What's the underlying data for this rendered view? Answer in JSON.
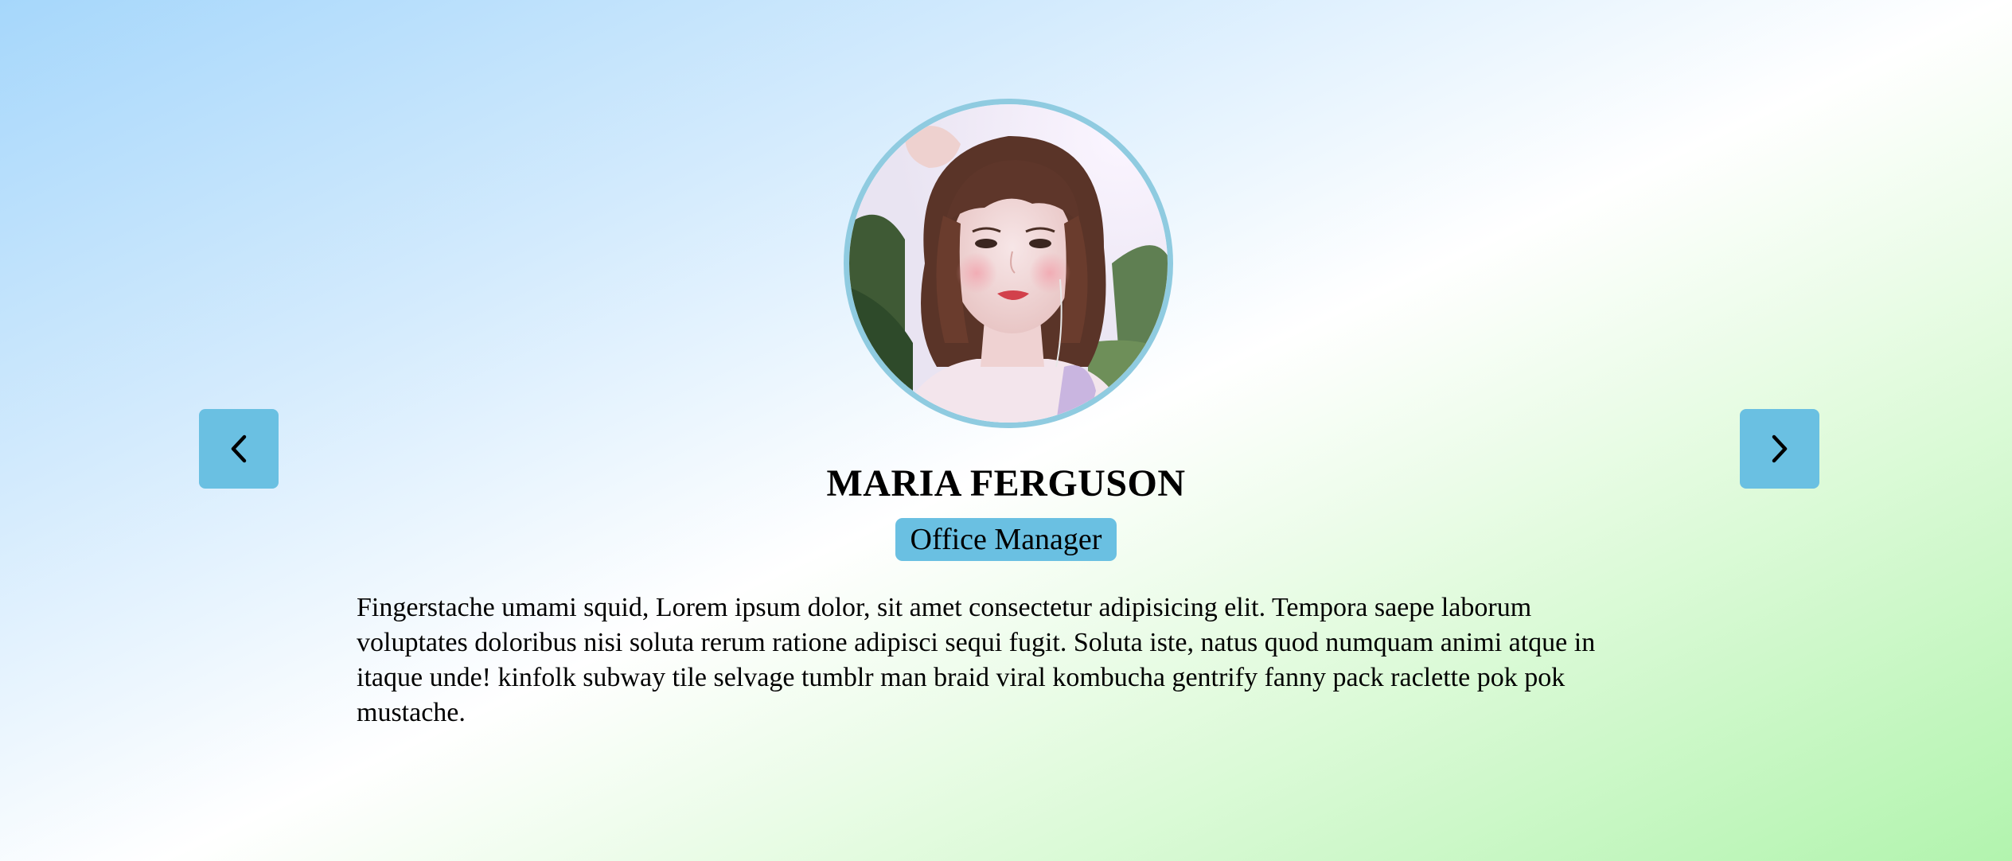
{
  "testimonial": {
    "name": "MARIA FERGUSON",
    "role": "Office Manager",
    "text": "Fingerstache umami squid, Lorem ipsum dolor, sit amet consectetur adipisicing elit. Tempora saepe laborum voluptates doloribus nisi soluta rerum ratione adipisci sequi fugit. Soluta iste, natus quod numquam animi atque in itaque unde! kinfolk subway tile selvage tumblr man braid viral kombucha gentrify fanny pack raclette pok pok mustache."
  },
  "icons": {
    "prev": "chevron-left-icon",
    "next": "chevron-right-icon"
  },
  "colors": {
    "accent": "#6ac0e2",
    "avatar_border": "#8fcbe0",
    "gradient": [
      "#a6d7fb",
      "#ffffff",
      "#b2f4ae"
    ]
  }
}
